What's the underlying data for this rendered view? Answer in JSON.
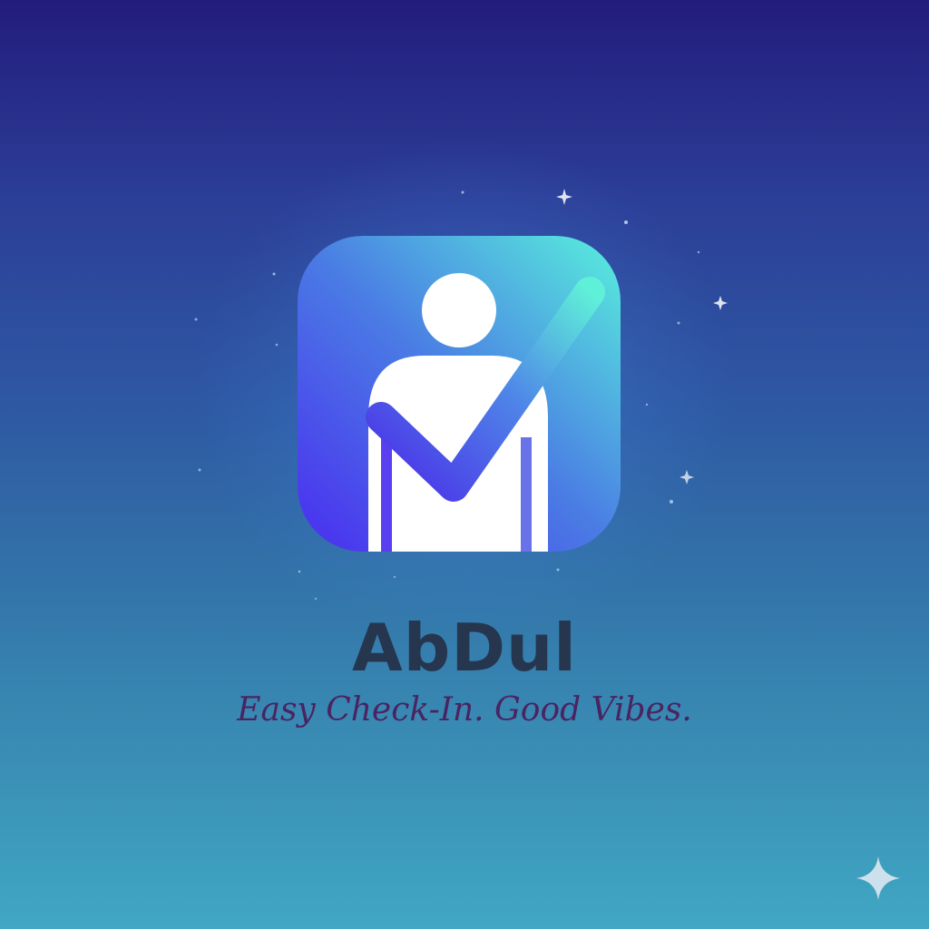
{
  "app": {
    "name": "AbDul",
    "tagline": "Easy Check-In. Good Vibes."
  },
  "colors": {
    "background_top": "#221c7d",
    "background_bottom": "#40a7c4",
    "icon_gradient_start": "#4a2df0",
    "icon_gradient_end": "#58f0dc",
    "name_text": "#26364f",
    "tagline_text": "#4a2460"
  },
  "icons": {
    "logo": "person-checkmark-icon",
    "corner": "sparkle-icon"
  }
}
